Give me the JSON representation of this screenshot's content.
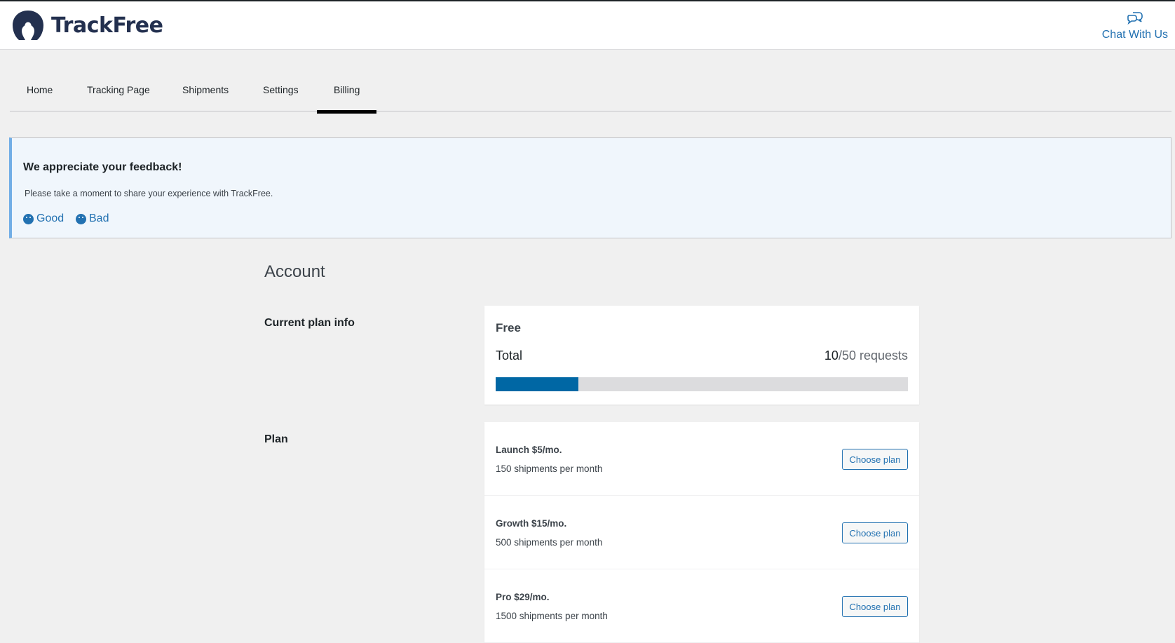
{
  "header": {
    "brand": "TrackFree",
    "chat_label": "Chat With Us"
  },
  "tabs": [
    {
      "label": "Home"
    },
    {
      "label": "Tracking Page"
    },
    {
      "label": "Shipments"
    },
    {
      "label": "Settings"
    },
    {
      "label": "Billing",
      "active": true
    }
  ],
  "feedback": {
    "title": "We appreciate your feedback!",
    "text": "Please take a moment to share your experience with TrackFree.",
    "good": "Good",
    "bad": "Bad"
  },
  "account": {
    "heading": "Account",
    "current_plan_label": "Current plan info",
    "plan_name": "Free",
    "total_label": "Total",
    "used": "10",
    "limit": "/50 requests",
    "usage_percent": 20,
    "plan_label": "Plan"
  },
  "plans": [
    {
      "title": "Launch $5/mo.",
      "desc": "150 shipments per month",
      "button": "Choose plan"
    },
    {
      "title": "Growth $15/mo.",
      "desc": "500 shipments per month",
      "button": "Choose plan"
    },
    {
      "title": "Pro $29/mo.",
      "desc": "1500 shipments per month",
      "button": "Choose plan"
    }
  ],
  "colors": {
    "accent": "#2271b1",
    "progress": "#0067a4",
    "brand": "#23304f"
  }
}
